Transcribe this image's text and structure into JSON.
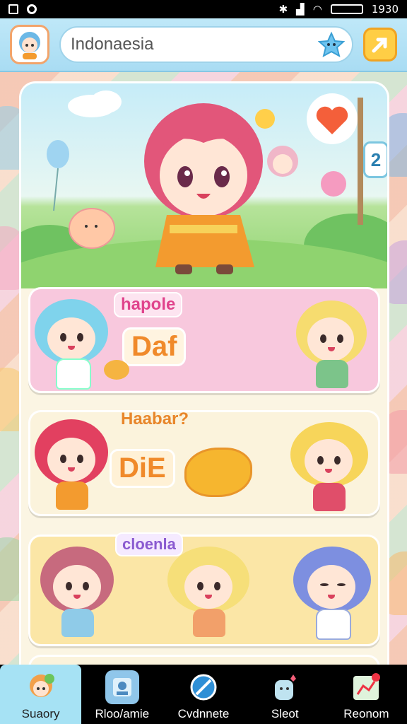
{
  "status_bar": {
    "time": "1930",
    "battery": ""
  },
  "header": {
    "search_value": "Indonaesia",
    "search_icon": "star-icon",
    "action_icon": "arrow-icon"
  },
  "sections": [
    {
      "title": "hapole",
      "word": "Daf"
    },
    {
      "title": "Haabar?",
      "word": "DiE"
    },
    {
      "title": "cloenla"
    }
  ],
  "hero": {
    "badge": "2"
  },
  "nav": [
    {
      "label": "Suaory",
      "icon": "character-icon",
      "active": true
    },
    {
      "label": "Rloo/amie",
      "icon": "photo-icon",
      "active": false
    },
    {
      "label": "Cvdnnete",
      "icon": "block-icon",
      "active": false
    },
    {
      "label": "Sleot",
      "icon": "toy-icon",
      "active": false
    },
    {
      "label": "Reonom",
      "icon": "chart-icon",
      "active": false
    }
  ],
  "colors": {
    "header": "#bfe8f8",
    "section_pink": "#f8c8dd",
    "section_cream": "#fbf3dc",
    "section_yellow": "#fbe6a6",
    "accent_orange": "#f39b2f"
  }
}
